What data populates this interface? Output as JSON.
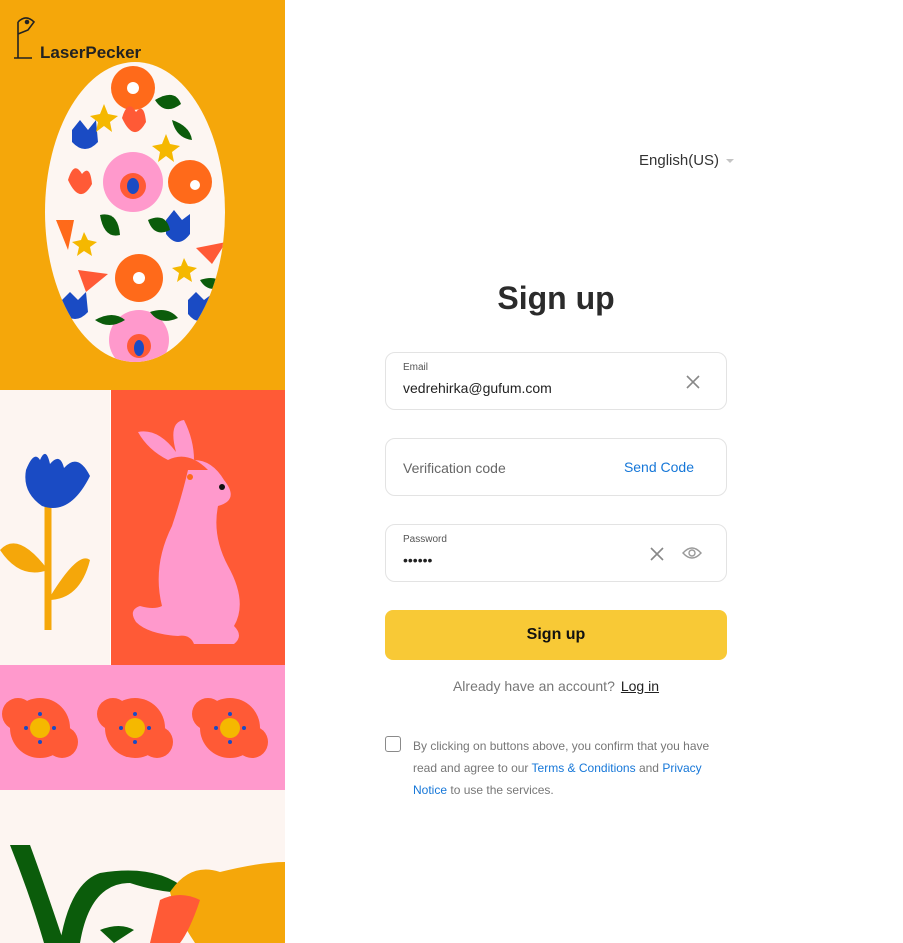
{
  "brand": {
    "name": "LaserPecker"
  },
  "language": {
    "label": "English(US)"
  },
  "form": {
    "title": "Sign up",
    "email": {
      "label": "Email",
      "value": "vedrehirka@gufum.com"
    },
    "code": {
      "placeholder": "Verification code",
      "send_label": "Send Code"
    },
    "password": {
      "label": "Password",
      "value": "••••••"
    },
    "submit_label": "Sign up"
  },
  "login": {
    "prompt": "Already have an account?",
    "link_label": "Log in"
  },
  "agreement": {
    "text_1": "By clicking on buttons above, you confirm that you have read and agree to our",
    "terms_label": "Terms & Conditions",
    "text_2": "and",
    "privacy_label": "Privacy Notice",
    "text_3": "to use the services."
  },
  "colors": {
    "accent_yellow": "#f8c936",
    "link_blue": "#1677d8",
    "art_orange": "#f5a70a",
    "art_red": "#ff5a36",
    "art_pink": "#ff99cc"
  }
}
